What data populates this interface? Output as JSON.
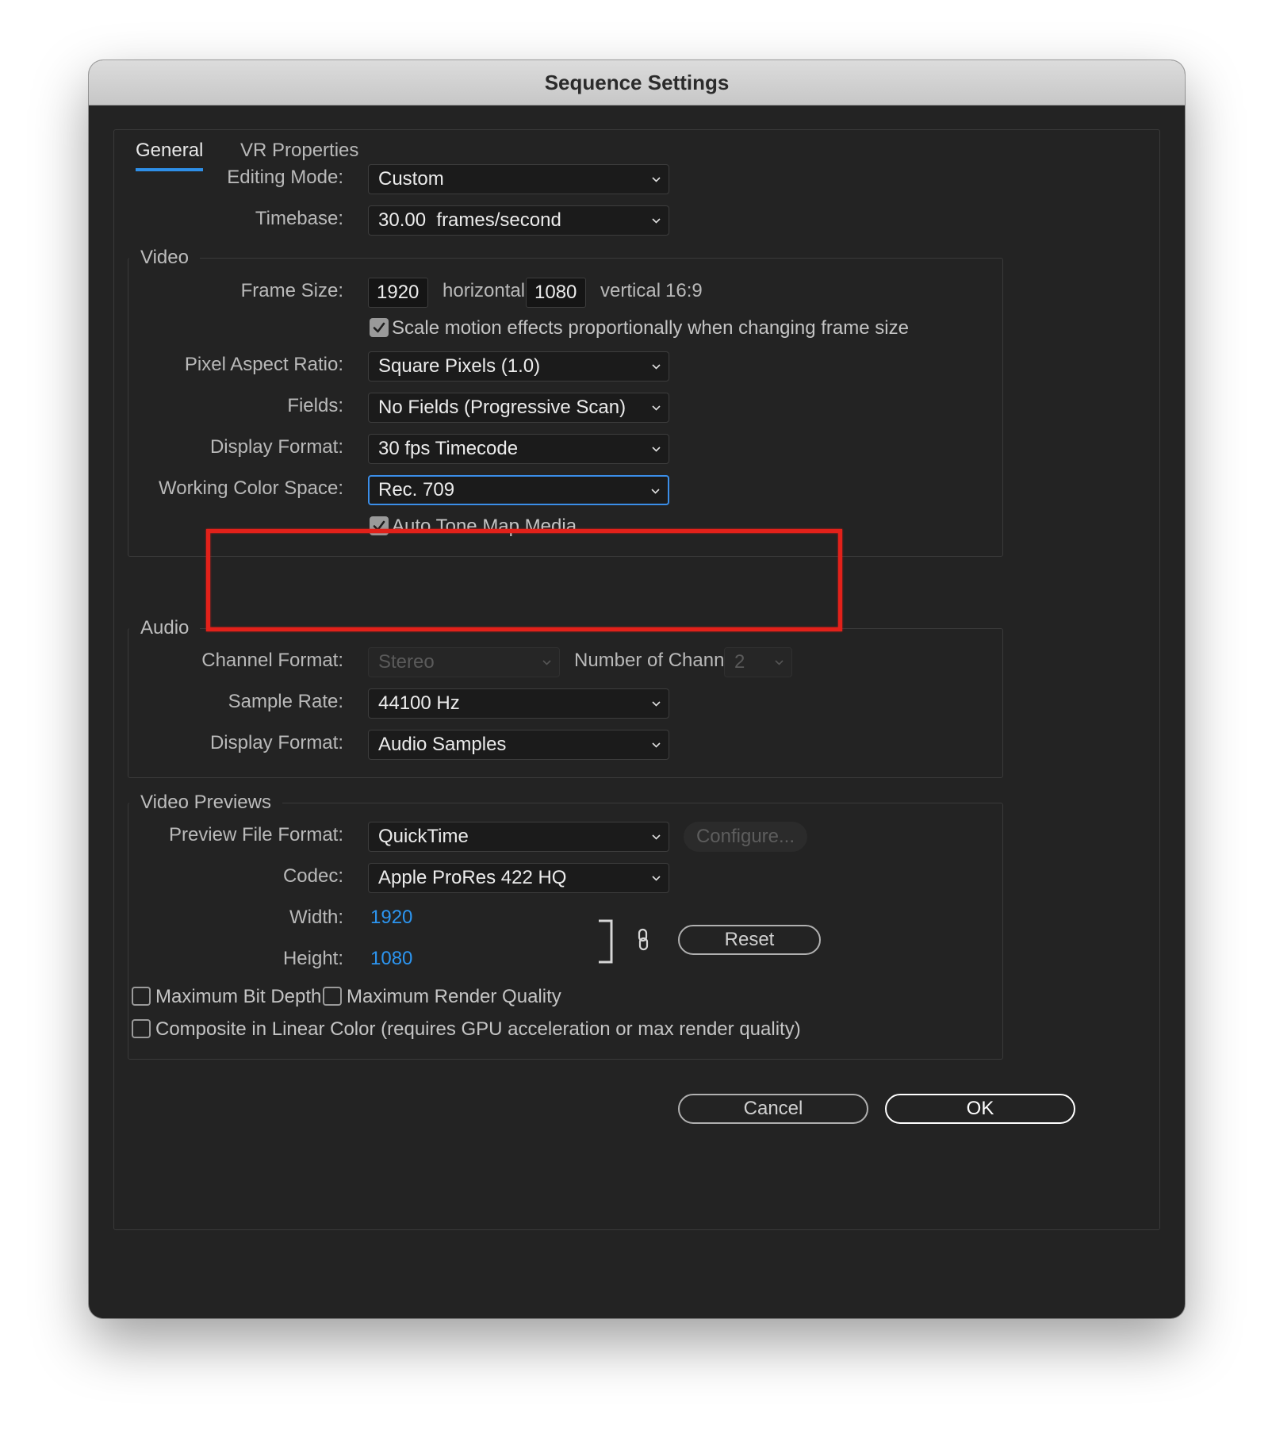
{
  "window": {
    "title": "Sequence Settings"
  },
  "tabs": [
    {
      "label": "General",
      "active": true
    },
    {
      "label": "VR Properties",
      "active": false
    }
  ],
  "general": {
    "editing_mode": {
      "label": "Editing Mode:",
      "value": "Custom"
    },
    "timebase": {
      "label": "Timebase:",
      "value": "30.00  frames/second"
    }
  },
  "video": {
    "legend": "Video",
    "frame_size": {
      "label": "Frame Size:",
      "width": "1920",
      "horizontal": "horizontal",
      "height": "1080",
      "vertical": "vertical",
      "aspect": "16:9"
    },
    "scale_motion": {
      "label": "Scale motion effects proportionally when changing frame size",
      "checked": true
    },
    "pixel_aspect": {
      "label": "Pixel Aspect Ratio:",
      "value": "Square Pixels (1.0)"
    },
    "fields": {
      "label": "Fields:",
      "value": "No Fields (Progressive Scan)"
    },
    "display_format": {
      "label": "Display Format:",
      "value": "30 fps Timecode"
    },
    "working_color_space": {
      "label": "Working Color Space:",
      "value": "Rec. 709"
    },
    "auto_tone_map": {
      "label": "Auto Tone Map Media",
      "checked": true
    }
  },
  "audio": {
    "legend": "Audio",
    "channel_format": {
      "label": "Channel Format:",
      "value": "Stereo"
    },
    "num_channels": {
      "label": "Number of Channels:",
      "value": "2"
    },
    "sample_rate": {
      "label": "Sample Rate:",
      "value": "44100 Hz"
    },
    "display_format": {
      "label": "Display Format:",
      "value": "Audio Samples"
    }
  },
  "previews": {
    "legend": "Video Previews",
    "file_format": {
      "label": "Preview File Format:",
      "value": "QuickTime"
    },
    "configure": "Configure...",
    "codec": {
      "label": "Codec:",
      "value": "Apple ProRes 422 HQ"
    },
    "width": {
      "label": "Width:",
      "value": "1920"
    },
    "height": {
      "label": "Height:",
      "value": "1080"
    },
    "reset": "Reset",
    "max_bit_depth": {
      "label": "Maximum Bit Depth",
      "checked": false
    },
    "max_render_quality": {
      "label": "Maximum Render Quality",
      "checked": false
    },
    "linear_color": {
      "label": "Composite in Linear Color (requires GPU acceleration or max render quality)",
      "checked": false
    }
  },
  "buttons": {
    "cancel": "Cancel",
    "ok": "OK"
  },
  "colors": {
    "accent": "#2e8fe8",
    "highlight": "#e2211a",
    "link_value": "#2c95f0"
  }
}
